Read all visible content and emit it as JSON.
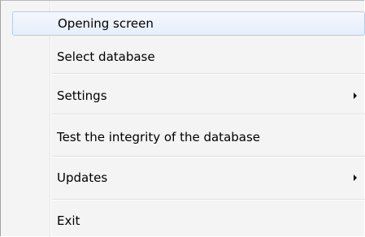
{
  "menu": {
    "items": [
      {
        "label": "Opening screen",
        "highlighted": true
      },
      {
        "label": "Select database"
      },
      {
        "label": "Settings",
        "submenu": true
      },
      {
        "label": "Test the integrity of the database"
      },
      {
        "label": "Updates",
        "submenu": true
      },
      {
        "label": "Exit"
      }
    ]
  }
}
